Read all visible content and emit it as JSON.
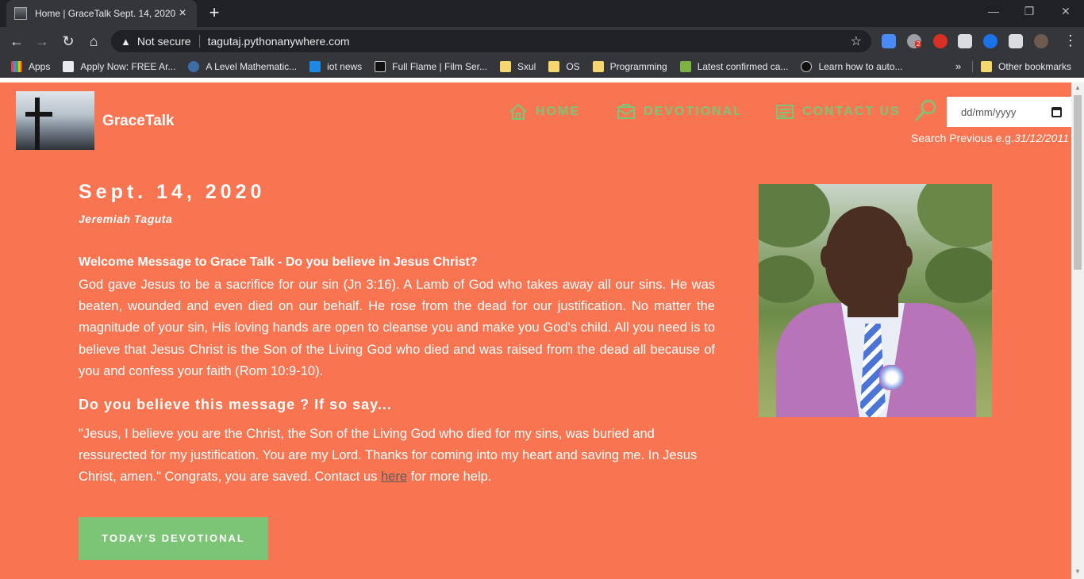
{
  "browser": {
    "tab_title": "Home | GraceTalk Sept. 14, 2020",
    "new_tab_symbol": "+",
    "close_symbol": "×",
    "security_label": "Not secure",
    "url": "tagutaj.pythonanywhere.com",
    "bookmarks": [
      {
        "label": "Apps"
      },
      {
        "label": "Apply Now: FREE Ar..."
      },
      {
        "label": "A Level Mathematic..."
      },
      {
        "label": "iot news"
      },
      {
        "label": "Full Flame | Film Ser..."
      },
      {
        "label": "Sxul"
      },
      {
        "label": "OS"
      },
      {
        "label": "Programming"
      },
      {
        "label": "Latest confirmed ca..."
      },
      {
        "label": "Learn how to auto..."
      }
    ],
    "bookmarks_overflow": "»",
    "other_bookmarks": "Other bookmarks",
    "extension_badge": "2"
  },
  "site": {
    "brand": "GraceTalk",
    "nav": [
      {
        "label": "HOME",
        "icon": "home-icon"
      },
      {
        "label": "DEVOTIONAL",
        "icon": "envelope-icon"
      },
      {
        "label": "CONTACT US",
        "icon": "contact-card-icon"
      }
    ],
    "search": {
      "placeholder": "dd/mm/yyyy",
      "hint_prefix": "Search Previous e.g.",
      "hint_example": "31/12/2011"
    },
    "colors": {
      "background": "#f97451",
      "accent": "#7dc576",
      "text": "#ffffff"
    }
  },
  "post": {
    "date": "Sept. 14, 2020",
    "author": "Jeremiah Taguta",
    "intro_heading": "Welcome Message to Grace Talk - Do you believe in Jesus Christ?",
    "body": "God gave Jesus to be a sacrifice for our sin (Jn 3:16). A Lamb of God who takes away all our sins. He was beaten, wounded and even died on our behalf. He rose from the dead for our justification. No matter the magnitude of your sin, His loving hands are open to cleanse you and make you God's child. All you need is to believe that Jesus Christ is the Son of the Living God who died and was raised from the dead all because of you and confess your faith (Rom 10:9-10).",
    "subheading": "Do you believe this message ? If so say...",
    "prayer_text": "\"Jesus, I believe you are the Christ, the Son of the Living God who died for my sins, was buried and ressurected for my justification. You are my Lord. Thanks for coming into my heart and saving me. In Jesus Christ, amen.\" Congrats, you are saved. Contact us",
    "prayer_link": "here",
    "prayer_suffix": "for more help.",
    "cta_label": "TODAY'S DEVOTIONAL"
  }
}
